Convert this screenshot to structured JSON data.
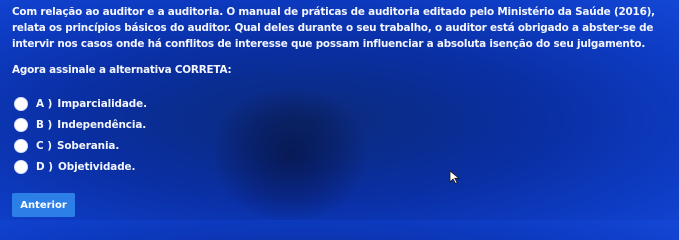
{
  "question": {
    "text": "Com relação ao auditor e a auditoria. O manual de práticas de auditoria editado pelo Ministério da Saúde (2016), relata os princípios básicos do auditor. Qual deles durante o seu trabalho, o auditor está obrigado a abster-se de intervir nos casos onde há conflitos de interesse que possam influenciar a absoluta isenção do seu julgamento.",
    "prompt": "Agora assinale a alternativa CORRETA:"
  },
  "options": [
    {
      "letter": "A )",
      "text": "Imparcialidade."
    },
    {
      "letter": "B )",
      "text": "Independência."
    },
    {
      "letter": "C )",
      "text": "Soberania."
    },
    {
      "letter": "D )",
      "text": "Objetividade."
    }
  ],
  "navigation": {
    "previous_label": "Anterior"
  },
  "colors": {
    "background": "#0d3bc2",
    "button": "#2b7fe6",
    "text": "#f4f6ff"
  }
}
